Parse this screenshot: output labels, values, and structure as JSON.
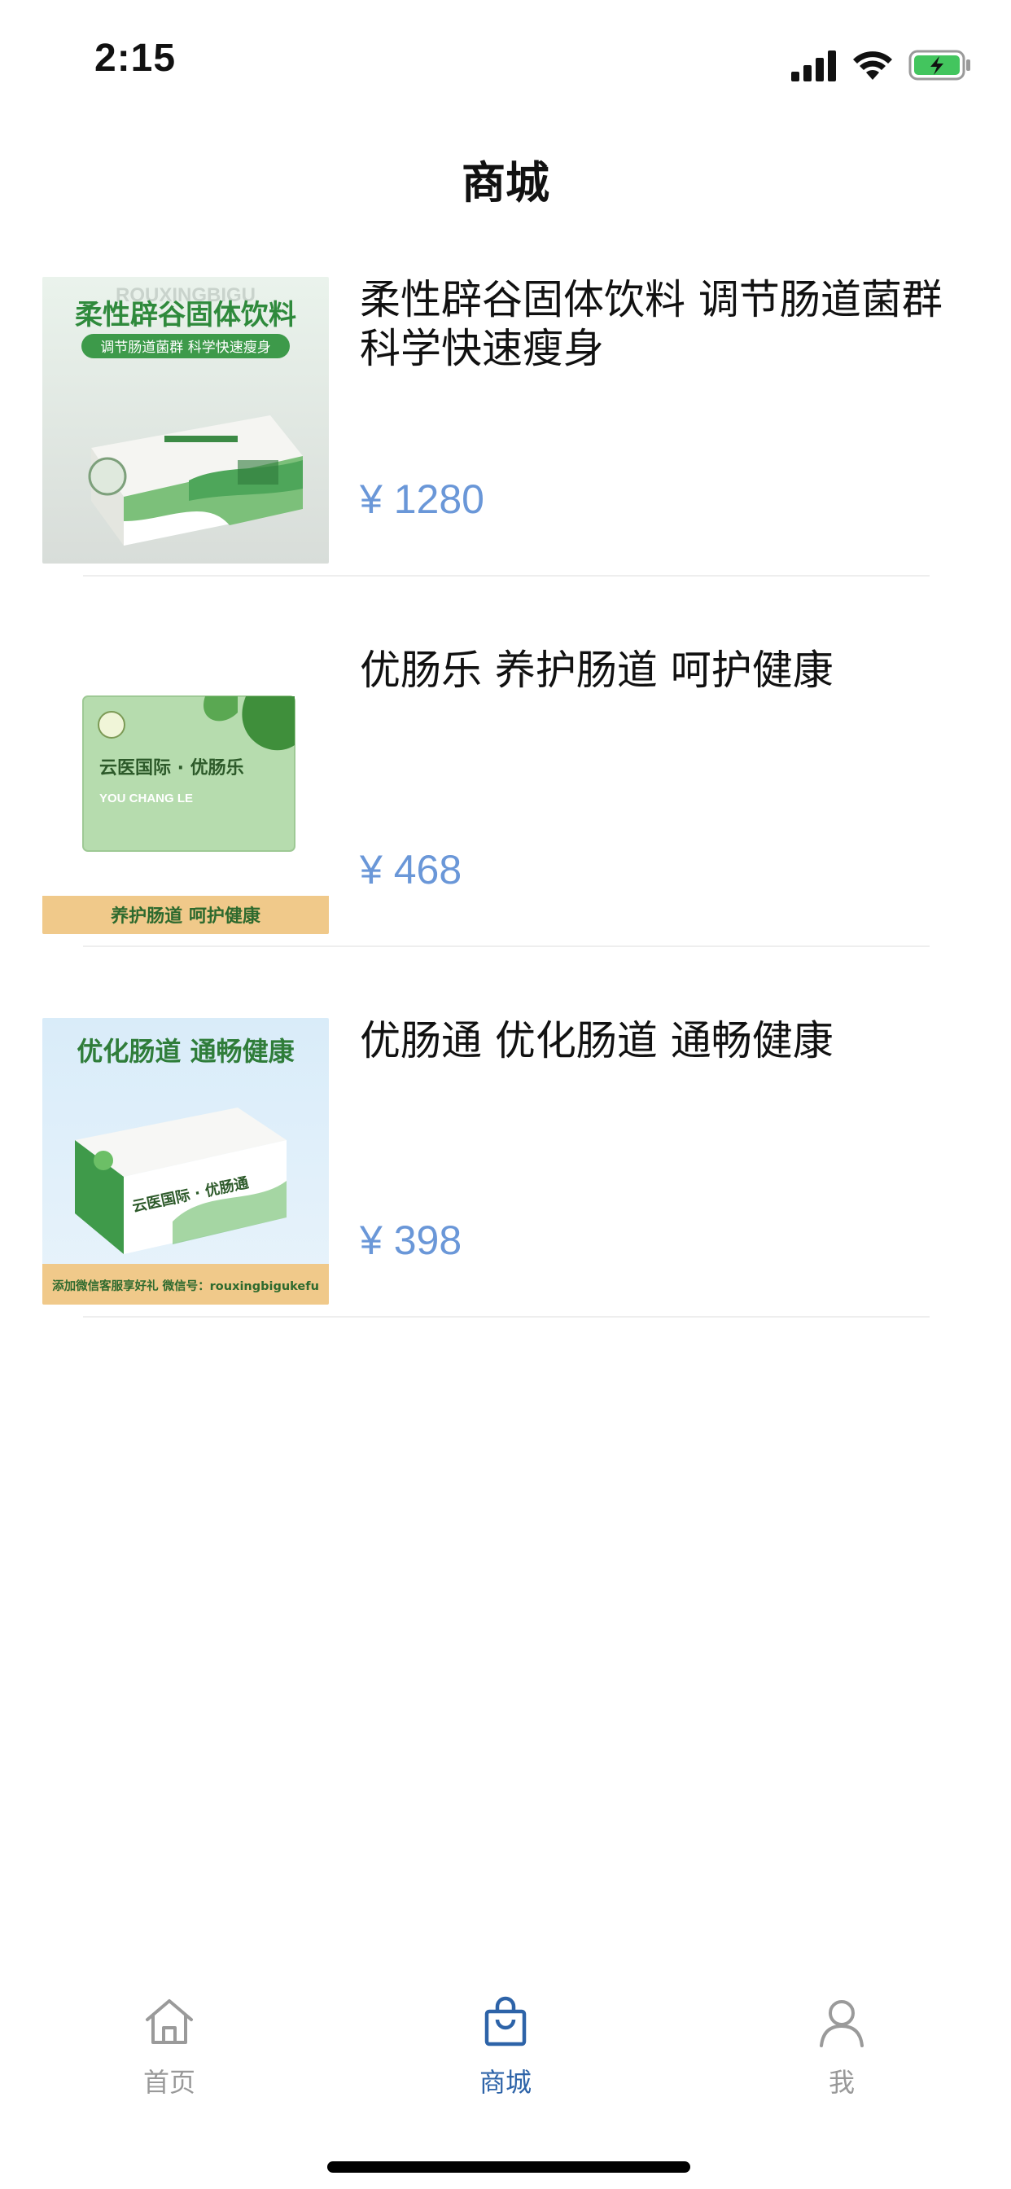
{
  "status_bar": {
    "time": "2:15"
  },
  "nav": {
    "title": "商城"
  },
  "products": [
    {
      "title": "柔性辟谷固体饮料 调节肠道菌群科学快速瘦身",
      "price": "¥ 1280",
      "image": {
        "banner_text": "柔性辟谷固体饮料",
        "sub_text": "调节肠道菌群 科学快速瘦身",
        "watermark": "ROUXINGBIGU"
      }
    },
    {
      "title": "优肠乐 养护肠道 呵护健康",
      "price": "¥ 468",
      "image": {
        "brand_text": "云医国际 · 优肠乐",
        "english_text": "YOU CHANG LE",
        "footer_text": "养护肠道  呵护健康"
      }
    },
    {
      "title": "优肠通 优化肠道 通畅健康",
      "price": "¥ 398",
      "image": {
        "banner_text": "优化肠道  通畅健康",
        "brand_text": "云医国际 · 优肠通",
        "footer_text": "添加微信客服享好礼 微信号：rouxingbigukefu"
      }
    }
  ],
  "tab_bar": {
    "tabs": [
      {
        "label": "首页",
        "icon": "home-icon",
        "active": false
      },
      {
        "label": "商城",
        "icon": "shopping-bag-icon",
        "active": true
      },
      {
        "label": "我",
        "icon": "person-icon",
        "active": false
      }
    ]
  },
  "colors": {
    "price": "#6a97d8",
    "tab_active": "#2d63a8",
    "tab_inactive": "#999999"
  }
}
